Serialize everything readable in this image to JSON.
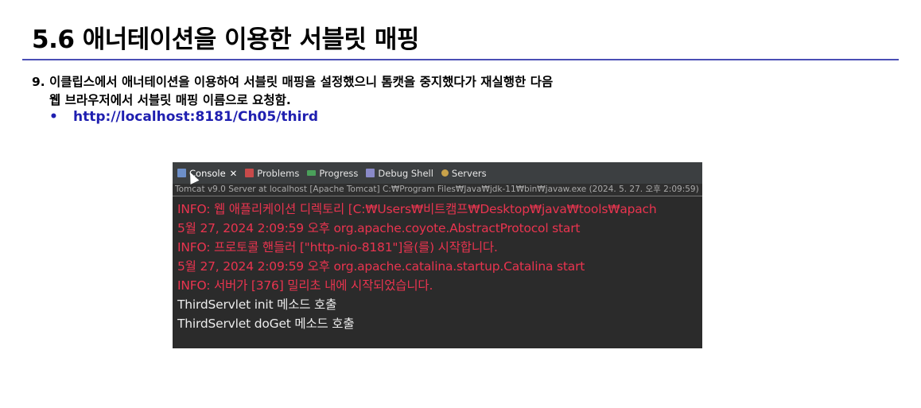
{
  "slide": {
    "title": "5.6 애너테이션을 이용한 서블릿 매핑",
    "step_number": "9.",
    "step_line1": "이클립스에서 애너테이션을 이용하여 서블릿 매핑을 설정했으니 톰캣을 중지했다가 재실행한 다음",
    "step_line2": "웹 브라우저에서 서블릿 매핑 이름으로 요청함.",
    "bullet_symbol": "•",
    "url": "http://localhost:8181/Ch05/third"
  },
  "console": {
    "tabs": [
      {
        "label": "Console",
        "close": "✕",
        "icon": "console-icon"
      },
      {
        "label": "Problems",
        "icon": "problems-icon"
      },
      {
        "label": "Progress",
        "icon": "progress-icon"
      },
      {
        "label": "Debug Shell",
        "icon": "debug-shell-icon"
      },
      {
        "label": "Servers",
        "icon": "servers-icon"
      }
    ],
    "server_info": "Tomcat v9.0 Server at localhost [Apache Tomcat] C:₩Program Files₩Java₩jdk-11₩bin₩javaw.exe (2024. 5. 27. 오후 2:09:59)",
    "lines": [
      {
        "text": "INFO: 웹 애플리케이션 디렉토리 [C:₩Users₩비트캠프₩Desktop₩java₩tools₩apach",
        "type": "err"
      },
      {
        "text": "5월 27, 2024 2:09:59 오후 org.apache.coyote.AbstractProtocol start",
        "type": "err"
      },
      {
        "text": "INFO: 프로토콜 핸들러 [\"http-nio-8181\"]을(를) 시작합니다.",
        "type": "err"
      },
      {
        "text": "5월 27, 2024 2:09:59 오후 org.apache.catalina.startup.Catalina start",
        "type": "err"
      },
      {
        "text": "INFO: 서버가 [376] 밀리초 내에 시작되었습니다.",
        "type": "err"
      },
      {
        "text": "ThirdServlet init 메소드 호출",
        "type": "out"
      },
      {
        "text": "ThirdServlet  doGet 메소드 호출",
        "type": "out"
      }
    ],
    "colors": {
      "error": "#e9344f",
      "output": "#ececec",
      "background": "#2b2b2b"
    }
  }
}
